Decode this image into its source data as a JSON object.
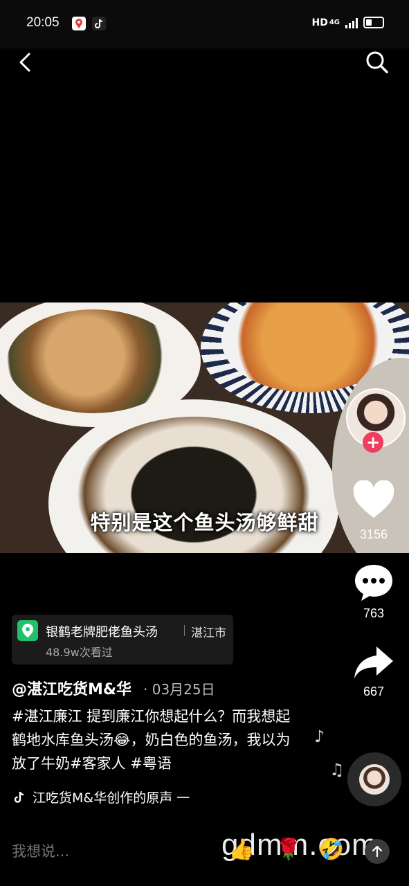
{
  "status_bar": {
    "time": "20:05",
    "network": "HD",
    "network_sub": "4G",
    "notification_icons": [
      "maps-icon",
      "tiktok-icon"
    ]
  },
  "nav": {
    "back_icon": "chevron-left-icon",
    "search_icon": "search-icon"
  },
  "video": {
    "subtitle": "特别是这个鱼头汤够鲜甜"
  },
  "side_actions": {
    "like_count": "3156",
    "comment_count": "763",
    "share_count": "667",
    "follow_label": "+"
  },
  "location": {
    "name": "银鹤老牌肥佬鱼头汤",
    "city": "湛江市",
    "views": "48.9w次看过"
  },
  "post": {
    "author": "@湛江吃货M&华",
    "date": "· 03月25日",
    "description": "#湛江廉江 提到廉江你想起什么？而我想起鹤地水库鱼头汤😂，奶白色的鱼汤，我以为放了牛奶#客家人 #粤语"
  },
  "music": {
    "title": "江吃货M&华创作的原声 一"
  },
  "comment_bar": {
    "placeholder": "我想说...",
    "watermark": "gdmm.com",
    "emojis": [
      "👍",
      "🌹",
      "🤣"
    ]
  },
  "colors": {
    "background": "#000000",
    "follow_accent": "#f03c5e",
    "location_green": "#1fc26b"
  }
}
